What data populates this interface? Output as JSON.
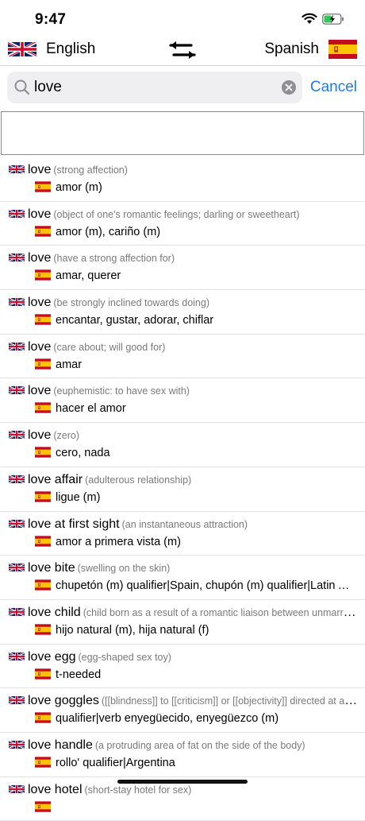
{
  "status": {
    "time": "9:47"
  },
  "languages": {
    "source": "English",
    "target": "Spanish"
  },
  "search": {
    "query": "love",
    "cancel_label": "Cancel"
  },
  "results": [
    {
      "term": "love",
      "gloss": "(strong affection)",
      "translation": "amor (m)"
    },
    {
      "term": "love",
      "gloss": "(object of one's romantic feelings; darling or sweetheart)",
      "translation": "amor (m), cariño (m)"
    },
    {
      "term": "love",
      "gloss": "(have a strong affection for)",
      "translation": "amar, querer"
    },
    {
      "term": "love",
      "gloss": "(be strongly inclined towards doing)",
      "translation": "encantar, gustar, adorar, chiflar"
    },
    {
      "term": "love",
      "gloss": "(care about; will good for)",
      "translation": "amar"
    },
    {
      "term": "love",
      "gloss": "(euphemistic: to have sex with)",
      "translation": "hacer el amor"
    },
    {
      "term": "love",
      "gloss": "(zero)",
      "translation": "cero, nada"
    },
    {
      "term": "love affair",
      "gloss": "(adulterous relationship)",
      "translation": "ligue (m)"
    },
    {
      "term": "love at first sight",
      "gloss": "(an instantaneous attraction)",
      "translation": "amor a primera vista (m)"
    },
    {
      "term": "love bite",
      "gloss": "(swelling on the skin)",
      "translation": "chupetón (m) qualifier|Spain, chupón (m) qualifier|Latin America"
    },
    {
      "term": "love child",
      "gloss": "(child born as a result of a romantic liaison between unmarried parents)",
      "translation": "hijo natural (m), hija natural (f)"
    },
    {
      "term": "love egg",
      "gloss": "(egg-shaped sex toy)",
      "translation": "t-needed"
    },
    {
      "term": "love goggles",
      "gloss": "([[blindness]] to [[criticism]] or [[objectivity]] directed at a loved one)",
      "translation": "qualifier|verb enyegüecido, enyegüezco (m)"
    },
    {
      "term": "love handle",
      "gloss": "(a protruding area of fat on the side of the body)",
      "translation": "rollo' qualifier|Argentina"
    },
    {
      "term": "love hotel",
      "gloss": "(short-stay hotel for sex)",
      "translation": ""
    }
  ]
}
